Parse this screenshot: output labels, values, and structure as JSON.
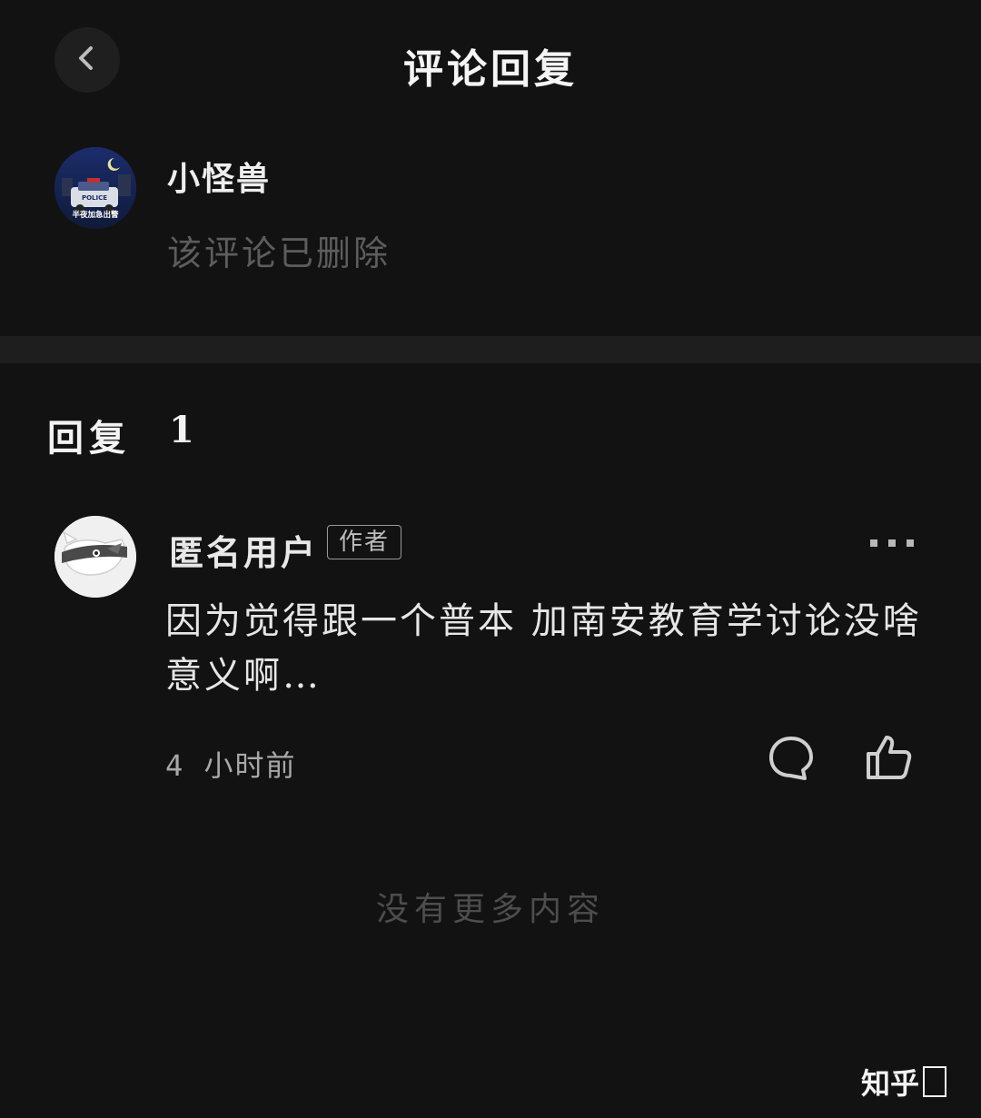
{
  "header": {
    "title": "评论回复",
    "back_icon": "chevron-left-icon"
  },
  "original_comment": {
    "author": "小怪兽",
    "body": "该评论已删除",
    "avatar_text": "半夜加急出警",
    "avatar_sign": "POLICE"
  },
  "replies": {
    "label": "回复",
    "count": "1"
  },
  "reply": {
    "author": "匿名用户",
    "badge": "作者",
    "body": "因为觉得跟一个普本 加南安教育学讨论没啥意义啊…",
    "time": "4 小时前",
    "icons": {
      "more": "more-dots-icon",
      "comment": "comment-bubble-icon",
      "like": "thumbs-up-icon"
    }
  },
  "footer": {
    "no_more": "没有更多内容"
  },
  "watermark": {
    "text": "知乎"
  },
  "colors": {
    "background": "#121212",
    "divider": "#1e1e1e",
    "text_primary": "#e6e6e6",
    "text_muted": "#5d5d5d"
  }
}
